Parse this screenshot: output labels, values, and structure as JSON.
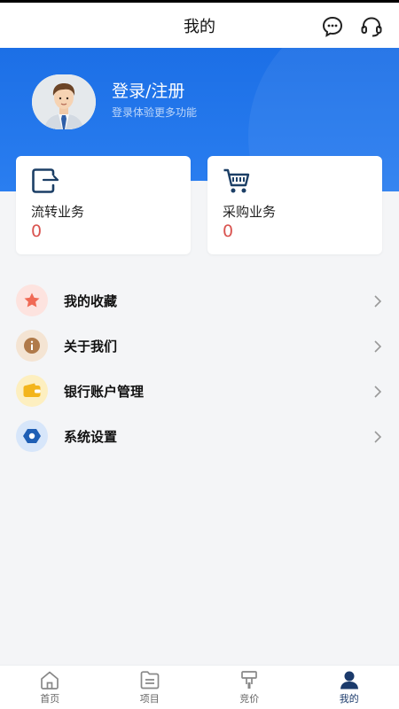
{
  "header": {
    "title": "我的"
  },
  "profile": {
    "title": "登录/注册",
    "subtitle": "登录体验更多功能"
  },
  "cards": [
    {
      "label": "流转业务",
      "value": "0",
      "icon": "transfer-icon"
    },
    {
      "label": "采购业务",
      "value": "0",
      "icon": "cart-icon"
    }
  ],
  "menu": [
    {
      "label": "我的收藏",
      "icon": "star-icon",
      "icon_color": "#f06a55",
      "bg": "#fde3df"
    },
    {
      "label": "关于我们",
      "icon": "info-icon",
      "icon_color": "#b07a4a",
      "bg": "#f4e4d3"
    },
    {
      "label": "银行账户管理",
      "icon": "wallet-icon",
      "icon_color": "#f3b51c",
      "bg": "#fdefc0"
    },
    {
      "label": "系统设置",
      "icon": "settings-icon",
      "icon_color": "#1f5fb5",
      "bg": "#d7e6fa"
    }
  ],
  "tabs": [
    {
      "label": "首页",
      "icon": "home-icon",
      "active": false
    },
    {
      "label": "项目",
      "icon": "folder-icon",
      "active": false
    },
    {
      "label": "竞价",
      "icon": "auction-icon",
      "active": false
    },
    {
      "label": "我的",
      "icon": "user-icon",
      "active": true
    }
  ],
  "colors": {
    "primary": "#1c6fe6",
    "accent_value": "#d9534f",
    "active_tab": "#1b3a6b"
  }
}
